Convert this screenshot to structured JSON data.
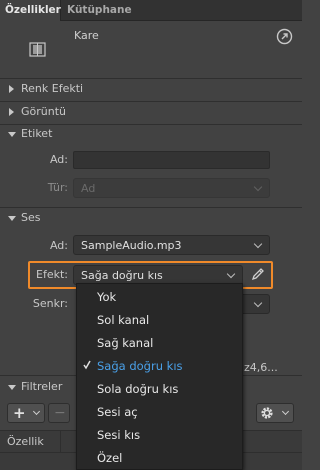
{
  "tabs": [
    {
      "label": "Özellikler",
      "active": true
    },
    {
      "label": "Kütüphane",
      "active": false
    }
  ],
  "symbol": {
    "name": "Kare",
    "icon": "symbol-icon"
  },
  "sections": {
    "renk_efekti": "Renk Efekti",
    "goruntu": "Görüntü",
    "etiket": "Etiket",
    "ses": "Ses",
    "filtreler": "Filtreler"
  },
  "etiket": {
    "ad_label": "Ad:",
    "ad_value": "",
    "tur_label": "Tür:",
    "tur_value": "Ad"
  },
  "ses": {
    "ad_label": "Ad:",
    "ad_value": "SampleAudio.mp3",
    "efekt_label": "Efekt:",
    "efekt_value": "Sağa doğru kıs",
    "senkr_label": "Senkr:",
    "info_partial": "z4,6..."
  },
  "efekt_menu": {
    "options": [
      "Yok",
      "Sol kanal",
      "Sağ kanal",
      "Sağa doğru kıs",
      "Sola doğru kıs",
      "Sesi aç",
      "Sesi kıs",
      "Özel"
    ],
    "selected": "Sağa doğru kıs"
  },
  "filters": {
    "add_symbol": "+",
    "remove_symbol": "−",
    "column_header": "Özellik"
  },
  "colors": {
    "highlight": "#f08a2a",
    "selected_text": "#4aa0e8",
    "panel_bg": "#424242"
  }
}
